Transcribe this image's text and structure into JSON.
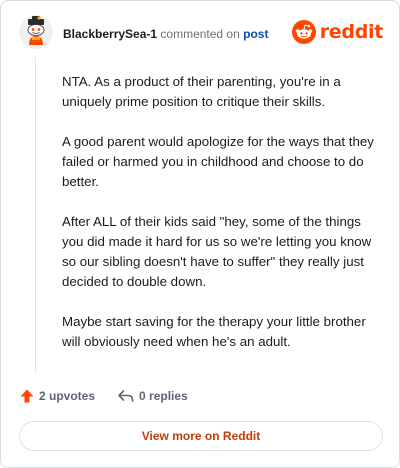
{
  "comment": {
    "username": "BlackberrySea-1",
    "action_text": "commented on",
    "post_link": "post",
    "paragraphs": [
      "NTA. As a product of their parenting, you're in a uniquely prime position to critique their skills.",
      "A good parent would apologize for the ways that they failed or harmed you in childhood and choose to do better.",
      "After ALL of their kids said \"hey, some of the things you did made it hard for us so we're letting you know so our sibling doesn't have to suffer\" they really just decided to double down.",
      "Maybe start saving for the therapy your little brother will obviously need when he's an adult."
    ]
  },
  "brand": {
    "name": "reddit",
    "icon": "reddit-logo-icon",
    "color": "#ff4500"
  },
  "actions": {
    "upvotes": "2 upvotes",
    "upvote_icon": "upvote-arrow-icon",
    "upvote_color": "#ff4500",
    "replies": "0 replies",
    "reply_icon": "reply-arrow-icon"
  },
  "footer": {
    "view_more": "View more on Reddit",
    "color": "#c23c0a"
  }
}
